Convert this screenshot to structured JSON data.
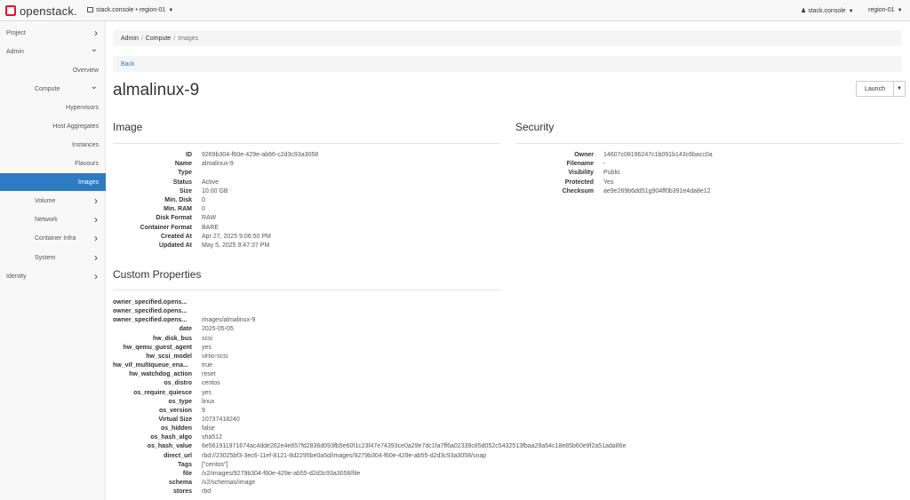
{
  "topbar": {
    "brand": "openstack.",
    "project_selector": "stack.console • region-01",
    "user_menu": "stack.console",
    "region_menu": "region-01"
  },
  "sidebar": {
    "items": [
      {
        "label": "Project",
        "level": 0,
        "chevron": "right"
      },
      {
        "label": "Admin",
        "level": 0,
        "chevron": "down"
      },
      {
        "label": "Overview",
        "level": 2
      },
      {
        "label": "Compute",
        "level": 1,
        "chevron": "down"
      },
      {
        "label": "Hypervisors",
        "level": 2
      },
      {
        "label": "Host Aggregates",
        "level": 2
      },
      {
        "label": "Instances",
        "level": 2
      },
      {
        "label": "Flavours",
        "level": 2
      },
      {
        "label": "Images",
        "level": 2,
        "active": true
      },
      {
        "label": "Volume",
        "level": 1,
        "chevron": "right"
      },
      {
        "label": "Network",
        "level": 1,
        "chevron": "right"
      },
      {
        "label": "Container Infra",
        "level": 1,
        "chevron": "right"
      },
      {
        "label": "System",
        "level": 1,
        "chevron": "right"
      },
      {
        "label": "Identity",
        "level": 0,
        "chevron": "right"
      }
    ]
  },
  "breadcrumb": [
    "Admin",
    "Compute",
    "Images"
  ],
  "back_link": "Back",
  "page_title": "almalinux-9",
  "launch_button": "Launch",
  "image_section": {
    "title": "Image",
    "fields": [
      {
        "key": "ID",
        "value": "9269b304-f60e-429e-ab66-c2d3c93a3058"
      },
      {
        "key": "Name",
        "value": "almalinux-9"
      },
      {
        "key": "Type",
        "value": ""
      },
      {
        "key": "Status",
        "value": "Active"
      },
      {
        "key": "Size",
        "value": "10.00 GB"
      },
      {
        "key": "Min. Disk",
        "value": "0"
      },
      {
        "key": "Min. RAM",
        "value": "0"
      },
      {
        "key": "Disk Format",
        "value": "RAW"
      },
      {
        "key": "Container Format",
        "value": "BARE"
      },
      {
        "key": "Created At",
        "value": "Apr 27, 2025 9:06:50 PM"
      },
      {
        "key": "Updated At",
        "value": "May 5, 2025 9:47:37 PM"
      }
    ]
  },
  "security_section": {
    "title": "Security",
    "fields": [
      {
        "key": "Owner",
        "value": "14607c08196247c1b091b143c6bacc0a"
      },
      {
        "key": "Filename",
        "value": "-"
      },
      {
        "key": "Visibility",
        "value": "Public"
      },
      {
        "key": "Protected",
        "value": "Yes"
      },
      {
        "key": "Checksum",
        "value": "ae9e269b6dd51g904ff0b391e4da8e12"
      }
    ]
  },
  "custom_section": {
    "title": "Custom Properties",
    "fields": [
      {
        "key": "owner_specified.opens...",
        "value": ""
      },
      {
        "key": "owner_specified.opens...",
        "value": ""
      },
      {
        "key": "owner_specified.opens...",
        "value": "images/almalinux-9"
      },
      {
        "key": "date",
        "value": "2025-05-05"
      },
      {
        "key": "hw_disk_bus",
        "value": "scsi"
      },
      {
        "key": "hw_qemu_guest_agent",
        "value": "yes"
      },
      {
        "key": "hw_scsi_model",
        "value": "virtio-scsi"
      },
      {
        "key": "hw_vif_multiqueue_ena...",
        "value": "true"
      },
      {
        "key": "hw_watchdog_action",
        "value": "reset"
      },
      {
        "key": "os_distro",
        "value": "centos"
      },
      {
        "key": "os_require_quiesce",
        "value": "yes"
      },
      {
        "key": "os_type",
        "value": "linux"
      },
      {
        "key": "os_version",
        "value": "9"
      },
      {
        "key": "Virtual Size",
        "value": "10737418240"
      },
      {
        "key": "os_hidden",
        "value": "false"
      },
      {
        "key": "os_hash_algo",
        "value": "sha512"
      },
      {
        "key": "os_hash_value",
        "value": "6e561911971674ac4dde262e4e857fd2836d093fb5e60f1c23f47e74393ce0a29e7dc1fa7ff6a02339c85d052c5432513fbaa29a54c18e85b60e9f2a51ada86e"
      },
      {
        "key": "direct_url",
        "value": "rbd://23025bf3-3ec6-11ef-8121-8d2295be0a5d/images/9279b304-f60e-429e-ab55-d2d3c93a3058/snap"
      },
      {
        "key": "Tags",
        "value": "[\"centos\"]"
      },
      {
        "key": "file",
        "value": "/v2/images/9279b304-f60e-429e-ab55-d2d3c93a3058/file"
      },
      {
        "key": "schema",
        "value": "/v2/schemas/image"
      },
      {
        "key": "stores",
        "value": "rbd"
      }
    ]
  }
}
